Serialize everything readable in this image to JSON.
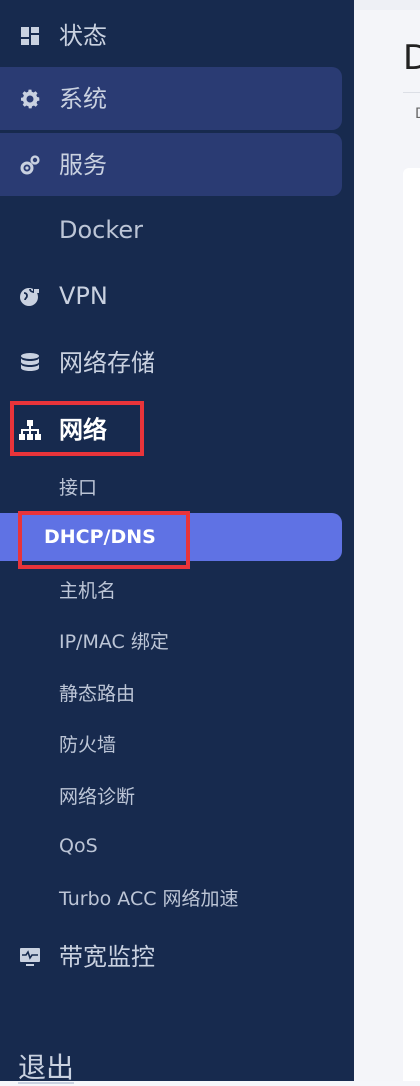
{
  "sidebar": {
    "status": {
      "label": "状态",
      "icon": "dashboard-grid-icon"
    },
    "system": {
      "label": "系统",
      "icon": "gear-icon"
    },
    "services": {
      "label": "服务",
      "icon": "gears-icon"
    },
    "docker": {
      "label": "Docker"
    },
    "vpn": {
      "label": "VPN",
      "icon": "globe-lock-icon"
    },
    "nas": {
      "label": "网络存储",
      "icon": "database-icon"
    },
    "network": {
      "label": "网络",
      "icon": "sitemap-icon",
      "items": [
        {
          "label": "接口"
        },
        {
          "label": "DHCP/DNS",
          "active": true
        },
        {
          "label": "主机名"
        },
        {
          "label": "IP/MAC 绑定"
        },
        {
          "label": "静态路由"
        },
        {
          "label": "防火墙"
        },
        {
          "label": "网络诊断"
        },
        {
          "label": "QoS"
        },
        {
          "label": "Turbo ACC 网络加速"
        }
      ]
    },
    "bandwidth": {
      "label": "带宽监控",
      "icon": "monitor-pulse-icon"
    },
    "logout": {
      "label": "退出"
    }
  },
  "main": {
    "title": "D",
    "breadcrumb": "D"
  },
  "colors": {
    "sidebar_bg": "#172a4e",
    "pill_bg": "#2a3b73",
    "active_bg": "#5f72e4",
    "highlight": "#e8343a"
  }
}
